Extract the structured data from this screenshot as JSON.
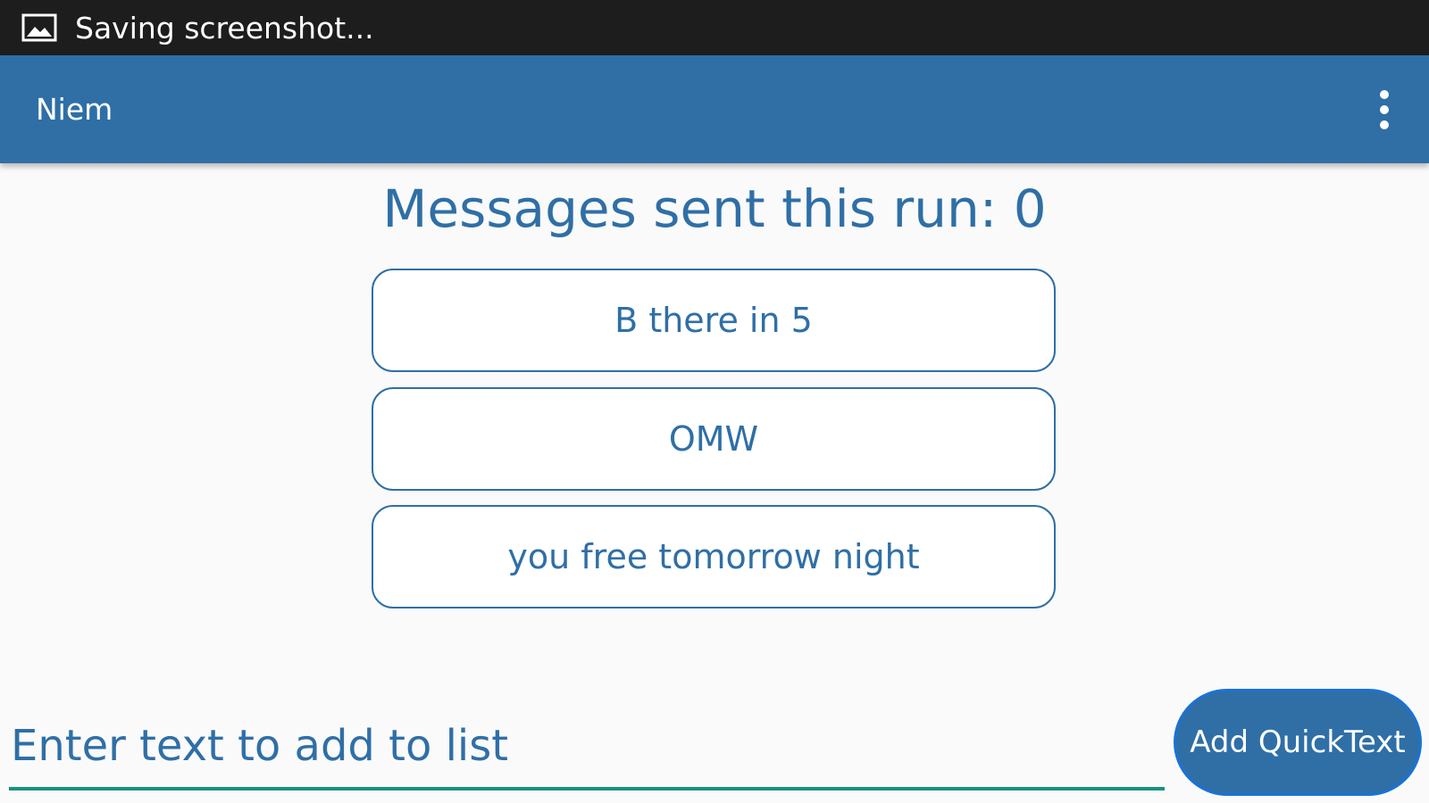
{
  "status_bar": {
    "icon": "image-icon",
    "text": "Saving screenshot..."
  },
  "app_bar": {
    "title": "Niem",
    "menu_icon": "more-vert-icon"
  },
  "counter": {
    "label": "Messages sent this run: 0"
  },
  "quick_texts": [
    {
      "label": "B there in 5"
    },
    {
      "label": "OMW"
    },
    {
      "label": "you free tomorrow night"
    }
  ],
  "input": {
    "value": "",
    "placeholder": "Enter text to add to list"
  },
  "add_button": {
    "label": "Add QuickText"
  },
  "colors": {
    "status_bar_bg": "#1d1d1d",
    "primary": "#2f6fa6",
    "background": "#fafafa",
    "input_underline": "#1a9180",
    "button_border": "#1a72d6"
  }
}
